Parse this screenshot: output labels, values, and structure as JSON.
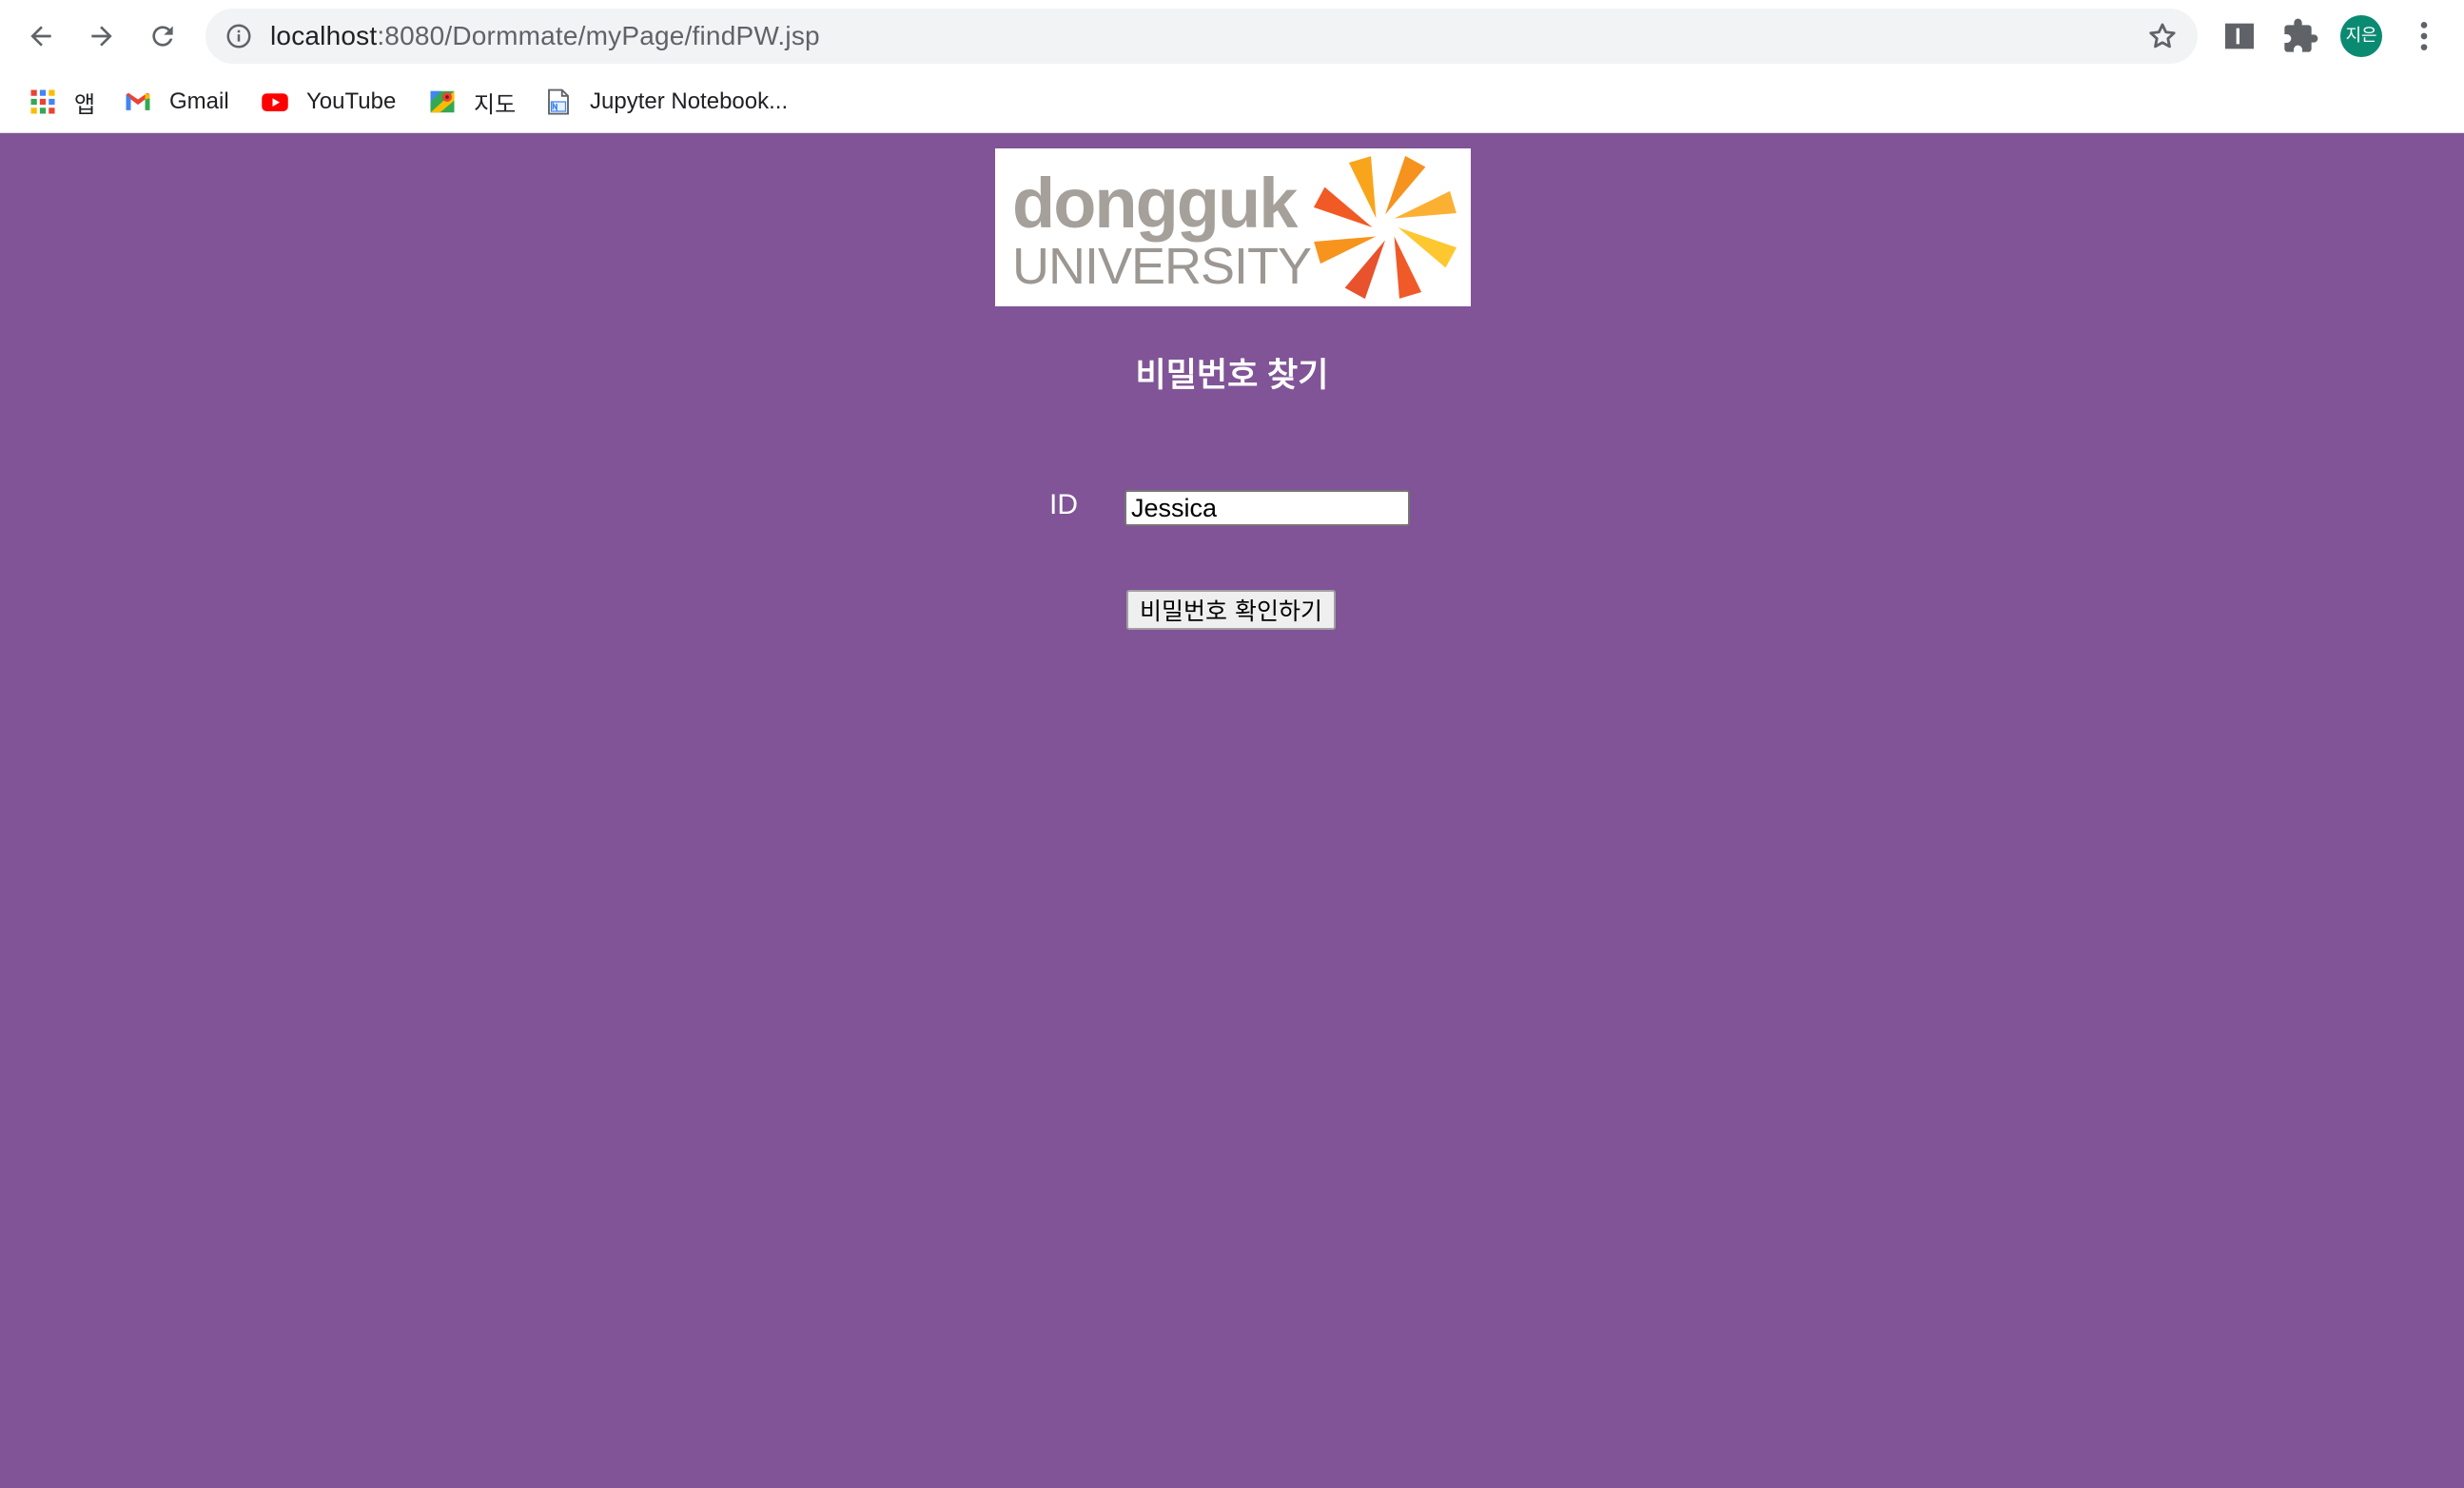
{
  "browser": {
    "url_host": "localhost",
    "url_path": ":8080/Dormmate/myPage/findPW.jsp",
    "profile_initials": "지은"
  },
  "bookmarks": [
    {
      "label": "앱",
      "icon": "apps-grid-icon"
    },
    {
      "label": "Gmail",
      "icon": "gmail-icon"
    },
    {
      "label": "YouTube",
      "icon": "youtube-icon"
    },
    {
      "label": "지도",
      "icon": "maps-icon"
    },
    {
      "label": "Jupyter Notebook...",
      "icon": "notebook-icon"
    }
  ],
  "page": {
    "background_color": "#805497",
    "logo": {
      "word": "dongguk",
      "sub": "UNIVERSITY"
    },
    "title": "비밀번호 찾기",
    "form": {
      "id_label": "ID",
      "id_value": "Jessica",
      "submit_label": "비밀번호 확인하기"
    }
  }
}
